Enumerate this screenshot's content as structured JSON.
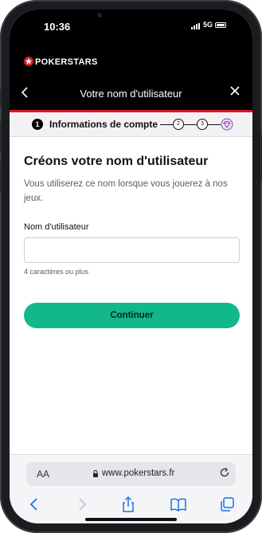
{
  "status_bar": {
    "time": "10:36",
    "network": "5G"
  },
  "brand": {
    "name": "POKERSTARS",
    "color": "#d71920"
  },
  "header": {
    "title": "Votre nom d'utilisateur",
    "back_icon": "chevron-left-icon",
    "close_icon": "close-icon"
  },
  "stepper": {
    "active_step": "1",
    "active_label": "Informations de compte",
    "steps": [
      "2",
      "3"
    ],
    "final_icon": "diamond-icon"
  },
  "form": {
    "heading": "Créons votre nom d'utilisateur",
    "description": "Vous utiliserez ce nom lorsque vous jouerez à nos jeux.",
    "field_label": "Nom d'utilisateur",
    "field_value": "",
    "hint": "4 caractères ou plus",
    "submit_label": "Continuer"
  },
  "browser": {
    "text_size_label": "AA",
    "url": "www.pokerstars.fr"
  },
  "colors": {
    "accent": "#13b88a",
    "header_bg": "#000000",
    "header_underline": "#d71920"
  }
}
